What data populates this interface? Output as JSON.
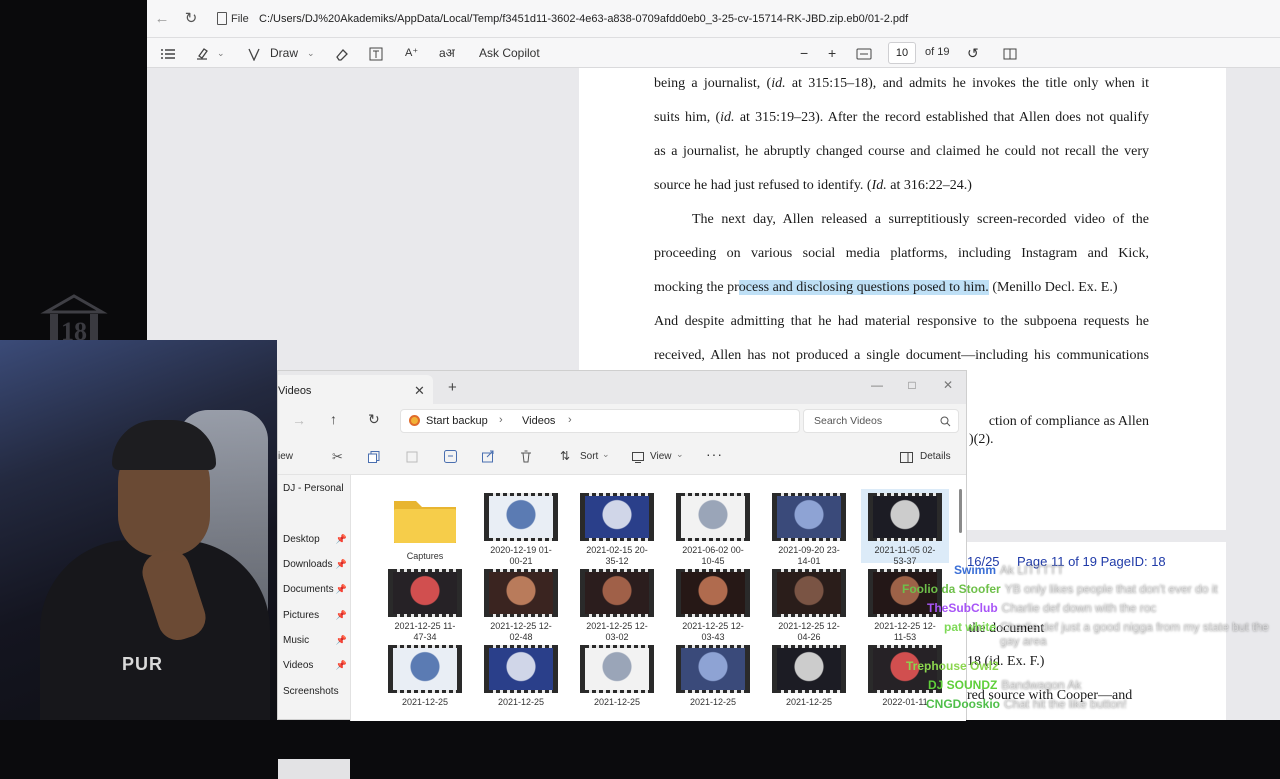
{
  "browser": {
    "url_prefix": "File",
    "url": "C:/Users/DJ%20Akademiks/AppData/Local/Temp/f3451d11-3602-4e63-a838-0709afdd0eb0_3-25-cv-15714-RK-JBD.zip.eb0/01-2.pdf"
  },
  "pdf_toolbar": {
    "draw_label": "Draw",
    "ask_copilot_label": "Ask Copilot",
    "page_number": "10",
    "page_total": "of 19"
  },
  "pdf_page": {
    "lines": [
      "being a journalist, (id. at 315:15–18), and admits he invokes the title only when it",
      "suits him, (id. at 315:19–23).  After the record established that Allen does not qualify",
      "as a journalist, he abruptly changed course and claimed he could not recall the very",
      "source he had just refused to identify.  (Id. at 316:22–24.)",
      "The next day, Allen released a surreptitiously screen-recorded video of the",
      "proceeding on various social media platforms, including Instagram and Kick,",
      "And despite admitting that he had material responsive to the subpoena requests he",
      "received, Allen has not produced a single document—including his communications"
    ],
    "mocking_pre": "mocking the pr",
    "mocking_highlight": "ocess and disclosing questions posed to him.",
    "mocking_post": " (Menillo Decl. Ex. E.)",
    "partial_line_1": "ction of compliance as Allen",
    "partial_line_2": ")(2)."
  },
  "pdf_page2": {
    "date_fragment": "16/25",
    "header": "Page 11 of 19 PageID: 18",
    "frag_1": "ntroduced the document",
    "frag_2": "18 (id. Ex. F.)",
    "frag_3": "red source with Cooper—and"
  },
  "explorer": {
    "tab_label": "Videos",
    "breadcrumb_root": "Start backup",
    "breadcrumb_folder": "Videos",
    "search_placeholder": "Search Videos",
    "cmd_view_frag": "iew",
    "cmd_sort": "Sort",
    "cmd_view": "View",
    "cmd_details": "Details",
    "nav_account": "DJ - Personal",
    "nav_items": [
      "Desktop",
      "Downloads",
      "Documents",
      "Pictures",
      "Music",
      "Videos",
      "Screenshots"
    ],
    "items": [
      {
        "name": "Captures",
        "kind": "folder"
      },
      {
        "name": "2020-12-19 01-00-21",
        "kind": "video"
      },
      {
        "name": "2021-02-15 20-35-12",
        "kind": "video"
      },
      {
        "name": "2021-06-02 00-10-45",
        "kind": "video"
      },
      {
        "name": "2021-09-20 23-14-01",
        "kind": "video"
      },
      {
        "name": "2021-11-05 02-53-37",
        "kind": "video"
      },
      {
        "name": "2021-12-25 11-47-34",
        "kind": "video"
      },
      {
        "name": "2021-12-25 12-02-48",
        "kind": "video"
      },
      {
        "name": "2021-12-25 12-03-02",
        "kind": "video"
      },
      {
        "name": "2021-12-25 12-03-43",
        "kind": "video"
      },
      {
        "name": "2021-12-25 12-04-26",
        "kind": "video"
      },
      {
        "name": "2021-12-25 12-11-53",
        "kind": "video"
      },
      {
        "name": "2021-12-25",
        "kind": "video"
      },
      {
        "name": "2021-12-25",
        "kind": "video"
      },
      {
        "name": "2021-12-25",
        "kind": "video"
      },
      {
        "name": "2021-12-25",
        "kind": "video"
      },
      {
        "name": "2021-12-25",
        "kind": "video"
      },
      {
        "name": "2022-01-11",
        "kind": "video"
      }
    ]
  },
  "webcam": {
    "shirt_text": "PUR"
  },
  "chat": [
    {
      "user": "Swimm",
      "message": "Ak LITTTTT",
      "color": "#3b6fd6"
    },
    {
      "user": "Foolio da Stoofer",
      "message": "YB only likes people that don't ever do it",
      "color": "#6ec04a"
    },
    {
      "user": "TheSubClub",
      "message": "Charlie def down with the roc",
      "color": "#a855f7"
    },
    {
      "user": "pat white",
      "message": "Charlie def just a good nigga from my state but the gay area",
      "color": "#7ed957"
    },
    {
      "user": "Trephouse Owl2",
      "message": "",
      "color": "#8bd64e"
    },
    {
      "user": "DJ SOUNDZ",
      "message": "Bandwagon Ak",
      "color": "#5fcf3a"
    },
    {
      "user": "CNGDooskio",
      "message": "Chat hit the like button!",
      "color": "#4fbf4a"
    }
  ],
  "colors": {
    "highlight": "#bfe0f6",
    "explorer_selection": "#dcebf8",
    "pdf_header_blue": "#1f3aa8"
  }
}
